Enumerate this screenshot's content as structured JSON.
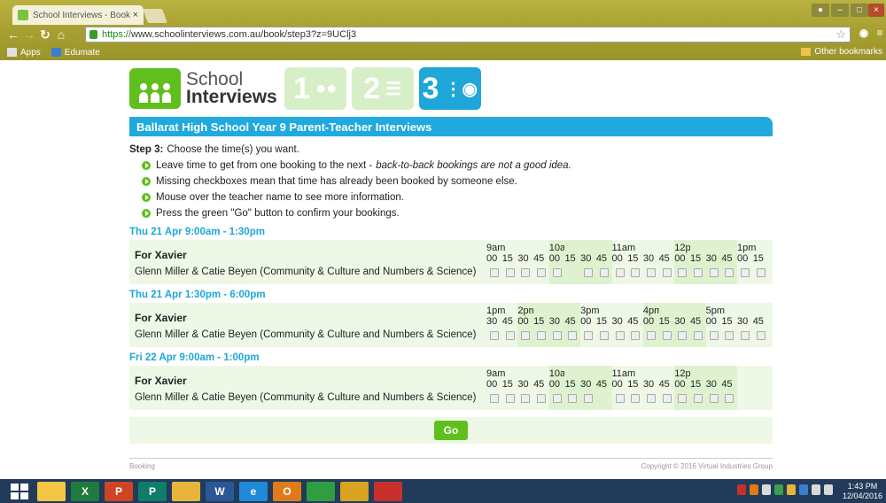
{
  "browser": {
    "tab_title": "School Interviews - Book",
    "tab_close": "×",
    "url_green": "https://",
    "url_rest": "www.schoolinterviews.com.au/book/step3?z=9UClj3",
    "bookmarks": [
      "Apps",
      "Edumate"
    ],
    "other_bookmarks": "Other bookmarks"
  },
  "logo": {
    "line1": "School",
    "line2": "Interviews"
  },
  "steps": [
    "1",
    "2",
    "3"
  ],
  "banner": "Ballarat High School Year 9 Parent-Teacher Interviews",
  "instructions": {
    "step_label": "Step 3:",
    "step_text": "Choose the time(s) you want.",
    "items": [
      {
        "text": "Leave time to get from one booking to the next -",
        "em": "back-to-back bookings are not a good idea."
      },
      {
        "text": "Missing checkboxes mean that time has already been booked by someone else.",
        "em": ""
      },
      {
        "text": "Mouse over the teacher name to see more information.",
        "em": ""
      },
      {
        "text": "Press the green \"Go\" button to confirm your bookings.",
        "em": ""
      }
    ]
  },
  "sessions": [
    {
      "heading": "Thu 21 Apr 9:00am - 1:30pm",
      "student": "For Xavier",
      "teacher": "Glenn Miller & Catie Beyen (Community & Culture and Numbers & Science)",
      "slots": [
        {
          "hour": "9am",
          "min": "00",
          "avail": true
        },
        {
          "hour": "",
          "min": "15",
          "avail": true
        },
        {
          "hour": "",
          "min": "30",
          "avail": true
        },
        {
          "hour": "",
          "min": "45",
          "avail": true
        },
        {
          "hour": "10am",
          "min": "00",
          "avail": true
        },
        {
          "hour": "",
          "min": "15",
          "avail": false
        },
        {
          "hour": "",
          "min": "30",
          "avail": true
        },
        {
          "hour": "",
          "min": "45",
          "avail": true
        },
        {
          "hour": "11am",
          "min": "00",
          "avail": true
        },
        {
          "hour": "",
          "min": "15",
          "avail": true
        },
        {
          "hour": "",
          "min": "30",
          "avail": true
        },
        {
          "hour": "",
          "min": "45",
          "avail": true
        },
        {
          "hour": "12pm",
          "min": "00",
          "avail": true
        },
        {
          "hour": "",
          "min": "15",
          "avail": true
        },
        {
          "hour": "",
          "min": "30",
          "avail": true
        },
        {
          "hour": "",
          "min": "45",
          "avail": true
        },
        {
          "hour": "1pm",
          "min": "00",
          "avail": true
        },
        {
          "hour": "",
          "min": "15",
          "avail": true
        }
      ]
    },
    {
      "heading": "Thu 21 Apr 1:30pm - 6:00pm",
      "student": "For Xavier",
      "teacher": "Glenn Miller & Catie Beyen (Community & Culture and Numbers & Science)",
      "slots": [
        {
          "hour": "1pm",
          "min": "30",
          "avail": true
        },
        {
          "hour": "",
          "min": "45",
          "avail": true
        },
        {
          "hour": "2pm",
          "min": "00",
          "avail": true
        },
        {
          "hour": "",
          "min": "15",
          "avail": true
        },
        {
          "hour": "",
          "min": "30",
          "avail": true
        },
        {
          "hour": "",
          "min": "45",
          "avail": true
        },
        {
          "hour": "3pm",
          "min": "00",
          "avail": true
        },
        {
          "hour": "",
          "min": "15",
          "avail": true
        },
        {
          "hour": "",
          "min": "30",
          "avail": true
        },
        {
          "hour": "",
          "min": "45",
          "avail": true
        },
        {
          "hour": "4pm",
          "min": "00",
          "avail": true
        },
        {
          "hour": "",
          "min": "15",
          "avail": true
        },
        {
          "hour": "",
          "min": "30",
          "avail": true
        },
        {
          "hour": "",
          "min": "45",
          "avail": true
        },
        {
          "hour": "5pm",
          "min": "00",
          "avail": true
        },
        {
          "hour": "",
          "min": "15",
          "avail": true
        },
        {
          "hour": "",
          "min": "30",
          "avail": true
        },
        {
          "hour": "",
          "min": "45",
          "avail": true
        }
      ]
    },
    {
      "heading": "Fri 22 Apr 9:00am - 1:00pm",
      "student": "For Xavier",
      "teacher": "Glenn Miller & Catie Beyen (Community & Culture and Numbers & Science)",
      "slots": [
        {
          "hour": "9am",
          "min": "00",
          "avail": true
        },
        {
          "hour": "",
          "min": "15",
          "avail": true
        },
        {
          "hour": "",
          "min": "30",
          "avail": true
        },
        {
          "hour": "",
          "min": "45",
          "avail": true
        },
        {
          "hour": "10am",
          "min": "00",
          "avail": true
        },
        {
          "hour": "",
          "min": "15",
          "avail": true
        },
        {
          "hour": "",
          "min": "30",
          "avail": true
        },
        {
          "hour": "",
          "min": "45",
          "avail": false
        },
        {
          "hour": "11am",
          "min": "00",
          "avail": true
        },
        {
          "hour": "",
          "min": "15",
          "avail": true
        },
        {
          "hour": "",
          "min": "30",
          "avail": true
        },
        {
          "hour": "",
          "min": "45",
          "avail": true
        },
        {
          "hour": "12pm",
          "min": "00",
          "avail": true
        },
        {
          "hour": "",
          "min": "15",
          "avail": true
        },
        {
          "hour": "",
          "min": "30",
          "avail": true
        },
        {
          "hour": "",
          "min": "45",
          "avail": true
        }
      ]
    }
  ],
  "go_label": "Go",
  "footer": {
    "left": "Booking",
    "right": "Copyright © 2016 Virtual Industries Group"
  },
  "taskbar": {
    "apps": [
      {
        "name": "file-explorer-icon",
        "label": "",
        "color": "#f3c744"
      },
      {
        "name": "excel-icon",
        "label": "X",
        "color": "#1f7a3e"
      },
      {
        "name": "powerpoint-icon",
        "label": "P",
        "color": "#d04423"
      },
      {
        "name": "publisher-icon",
        "label": "P",
        "color": "#107c6b"
      },
      {
        "name": "folder-icon",
        "label": "",
        "color": "#e8b53a"
      },
      {
        "name": "word-icon",
        "label": "W",
        "color": "#2b5797"
      },
      {
        "name": "internet-explorer-icon",
        "label": "e",
        "color": "#1f8ad8"
      },
      {
        "name": "outlook-icon",
        "label": "O",
        "color": "#e07b1a"
      },
      {
        "name": "store-icon",
        "label": "",
        "color": "#2e9e3e"
      },
      {
        "name": "chrome-icon",
        "label": "",
        "color": "#d9a321"
      },
      {
        "name": "pdf-icon",
        "label": "",
        "color": "#c9302c"
      }
    ],
    "time": "1:43 PM",
    "date": "12/04/2016"
  }
}
